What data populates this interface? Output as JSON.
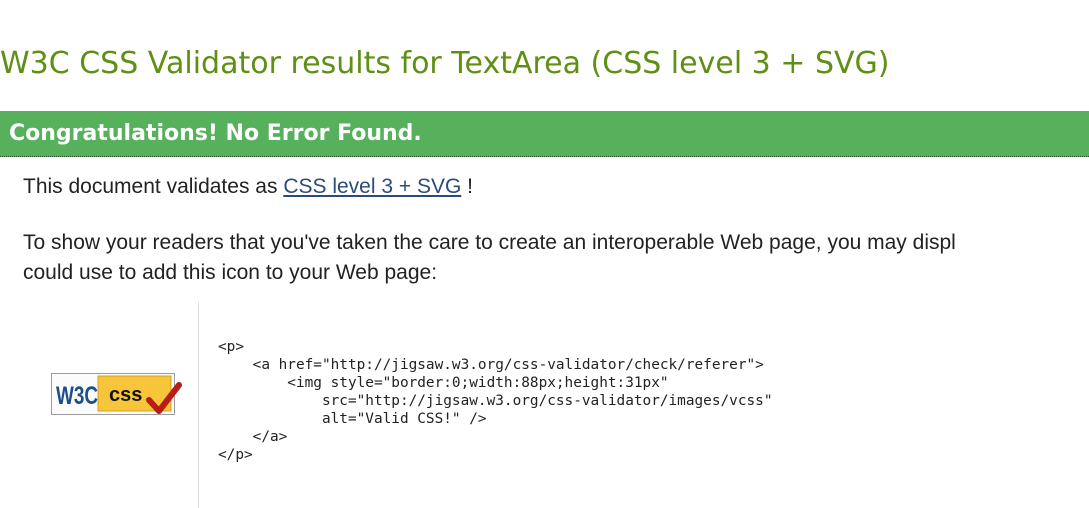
{
  "page": {
    "title": "W3C CSS Validator results for TextArea (CSS level 3 + SVG)"
  },
  "banner": {
    "text": "Congratulations! No Error Found.",
    "color": "#57b05b"
  },
  "result": {
    "validates_prefix": "This document validates as",
    "profile_link": "CSS level 3 + SVG",
    "validates_suffix": " !"
  },
  "instructions": {
    "line1": "To show your readers that you've taken the care to create an interoperable Web page, you may displ",
    "line2": "could use to add this icon to your Web page:"
  },
  "badge": {
    "icon": "valid-css-badge-icon",
    "w3c_text": "W3C",
    "css_text": "css"
  },
  "code_snippet": {
    "lines": [
      "<p>",
      "    <a href=\"http://jigsaw.w3.org/css-validator/check/referer\">",
      "        <img style=\"border:0;width:88px;height:31px\"",
      "            src=\"http://jigsaw.w3.org/css-validator/images/vcss\"",
      "            alt=\"Valid CSS!\" />",
      "    </a>",
      "</p>"
    ]
  }
}
